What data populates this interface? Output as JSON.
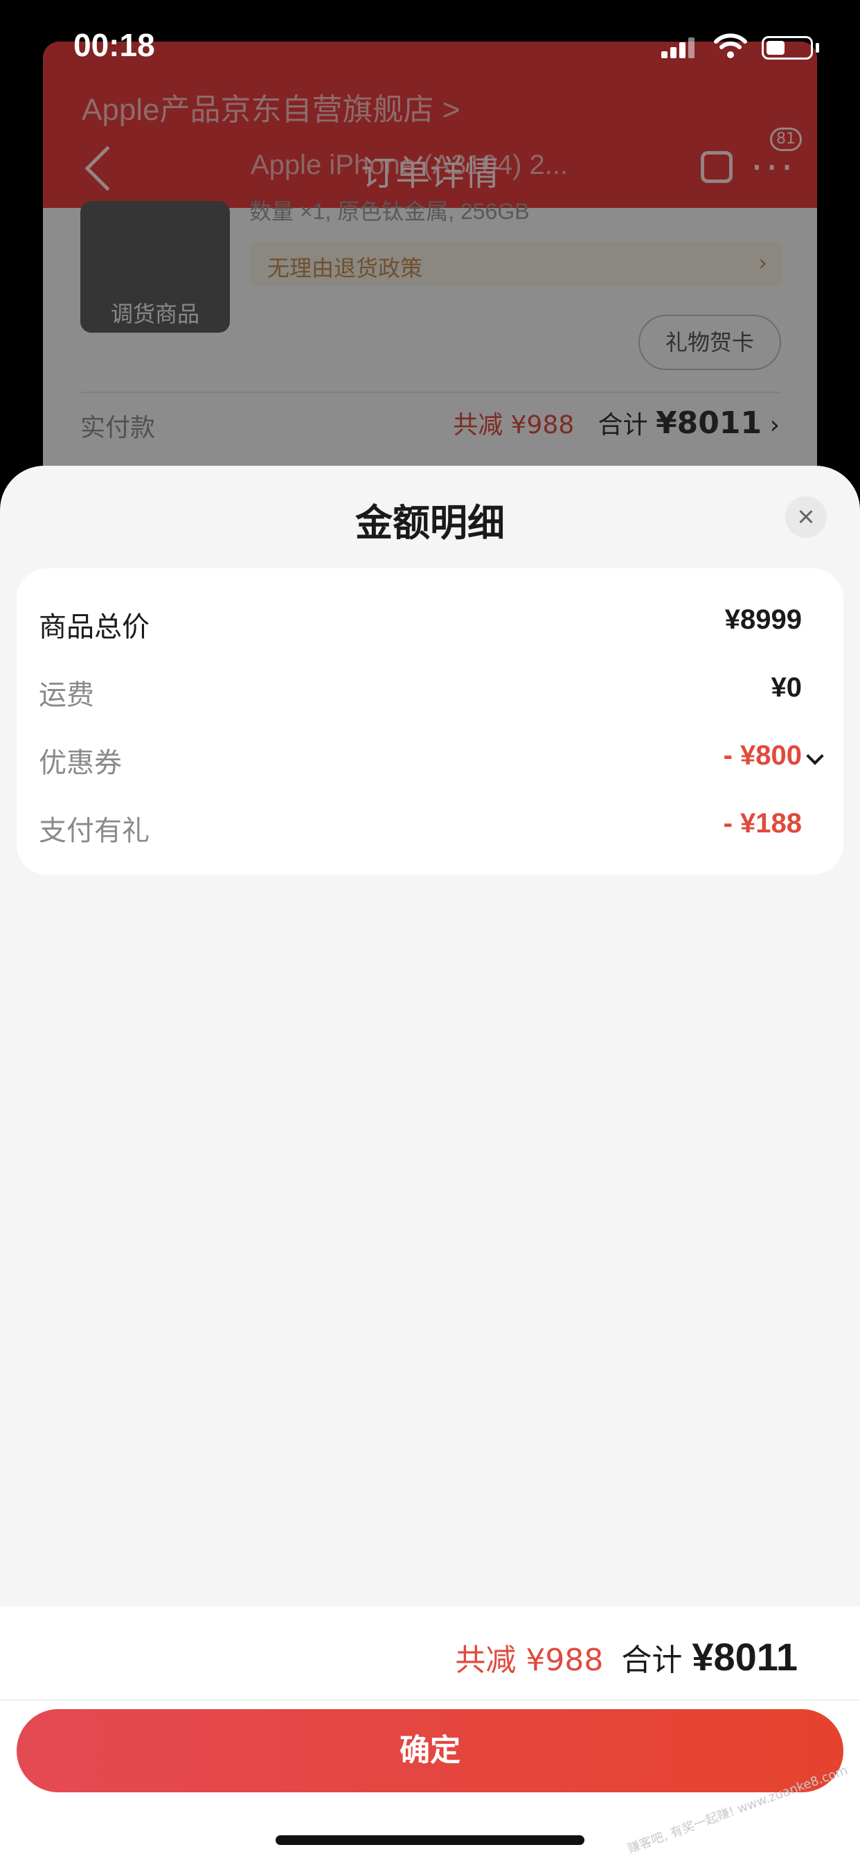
{
  "status_bar": {
    "time": "00:18"
  },
  "background": {
    "shop_name": "Apple产品京东自营旗舰店 >",
    "nav_title": "订单详情",
    "product_name": "Apple iPhone (A3104) 2...",
    "more_badge": "81",
    "product_thumb_label": "调货商品",
    "quantity_spec": "数量 ×1, 原色钛金属, 256GB",
    "policy_text": "无理由退货政策",
    "policy_arrow": "›",
    "gift_card_label": "礼物贺卡",
    "paid_label": "实付款",
    "paid_discount": "共减 ¥988",
    "paid_total_label": "合计",
    "paid_total_value": "¥8011",
    "paid_arrow": "›"
  },
  "sheet": {
    "title": "金额明细",
    "rows": [
      {
        "label": "商品总价",
        "value": "¥8999"
      },
      {
        "label": "运费",
        "value": "¥0"
      },
      {
        "label": "优惠券",
        "value": "- ¥800"
      },
      {
        "label": "支付有礼",
        "value": "- ¥188"
      }
    ]
  },
  "footer": {
    "discount": "共减 ¥988",
    "total_label": "合计",
    "total_value": "¥8011",
    "confirm_label": "确定"
  },
  "watermark": "赚客吧, 有奖一起赚! www.zuanke8.com",
  "colors": {
    "accent": "#e5432e",
    "discount_red": "#e04a3c",
    "sheet_bg": "#f5f5f5"
  }
}
